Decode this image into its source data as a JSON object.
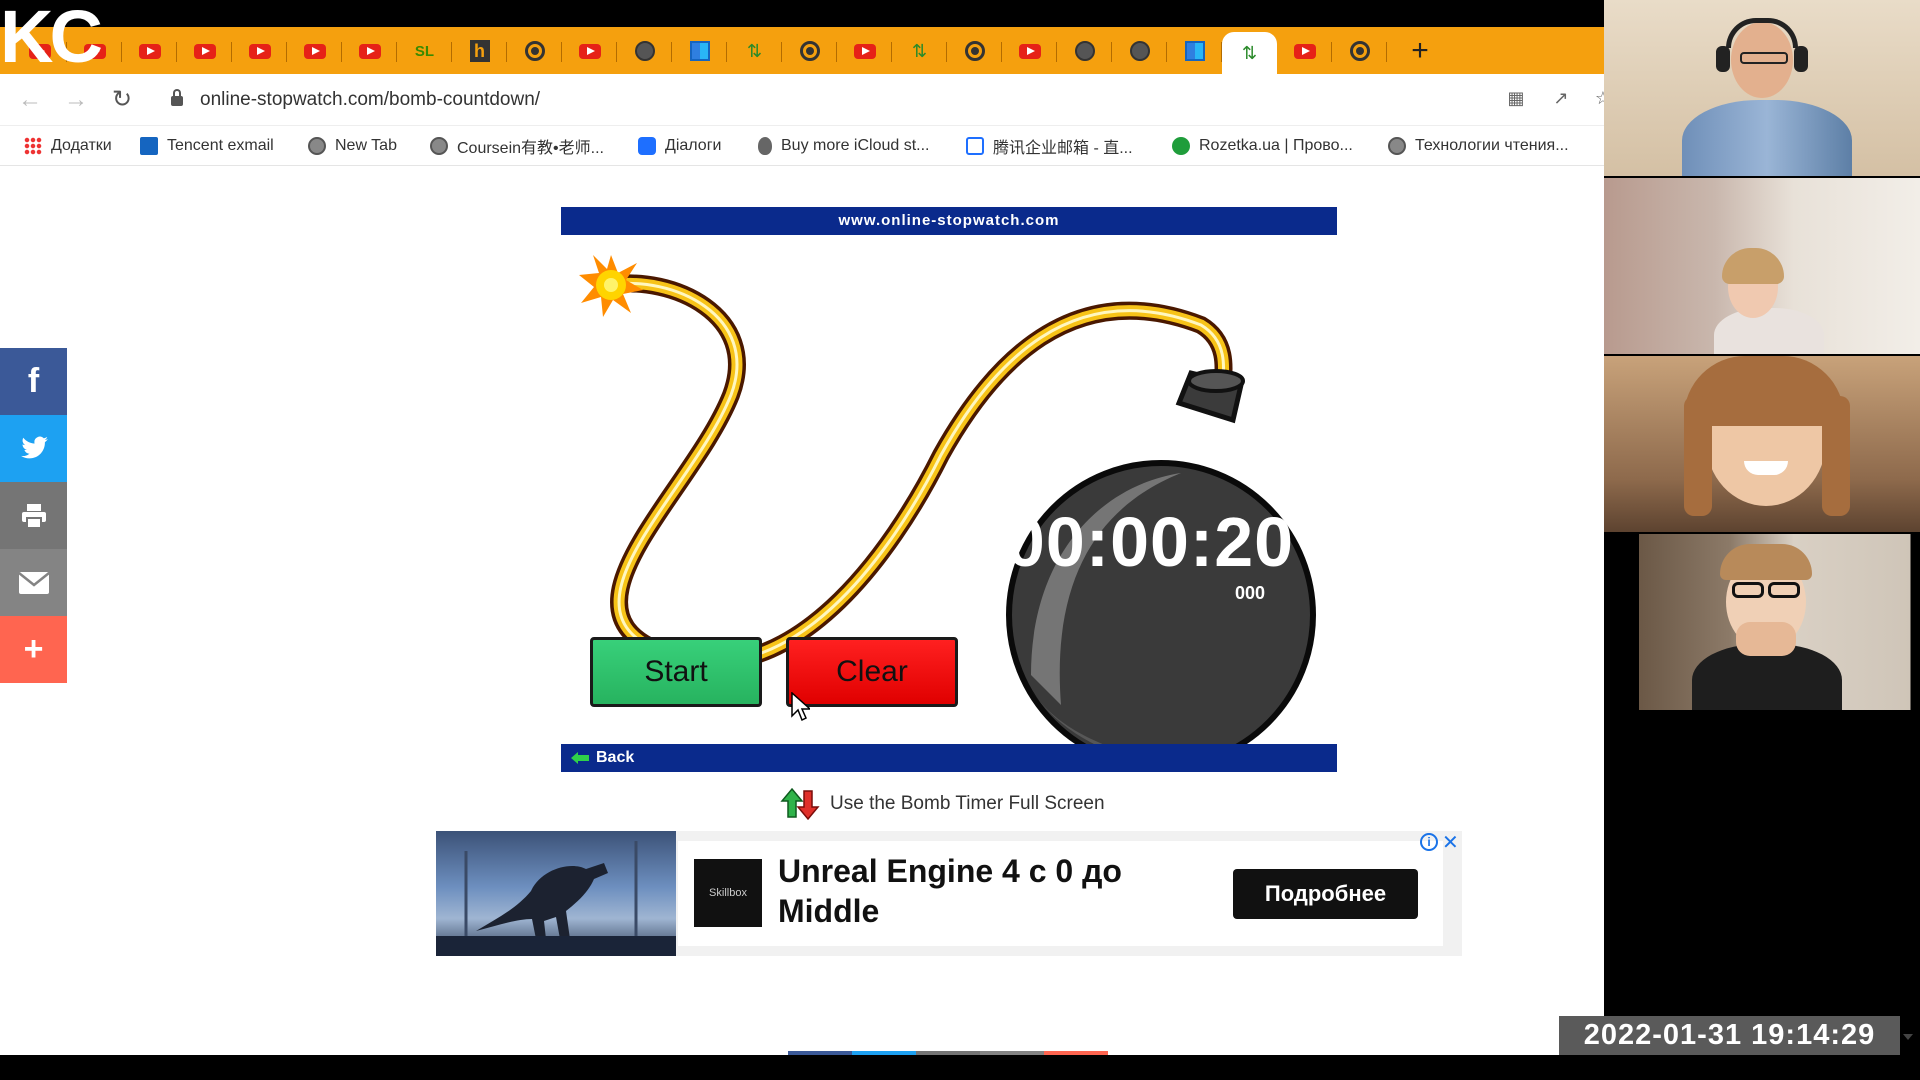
{
  "browser": {
    "logo_text": "KC",
    "url": "online-stopwatch.com/bomb-countdown/",
    "tabs": [
      "youtube",
      "youtube",
      "youtube",
      "youtube",
      "youtube",
      "youtube",
      "youtube",
      "sl",
      "h",
      "chrome",
      "youtube",
      "globe",
      "grid",
      "arrows",
      "chrome",
      "youtube",
      "arrows",
      "chrome",
      "youtube",
      "globe",
      "globe",
      "grid",
      "arrows",
      "youtube",
      "chrome"
    ],
    "active_tab_index": 22,
    "new_tab_label": "+",
    "bookmarks": [
      {
        "icon": "apps-icon",
        "label": "Додатки"
      },
      {
        "icon": "tencent-icon",
        "label": "Tencent exmail"
      },
      {
        "icon": "globe-icon",
        "label": "New Tab"
      },
      {
        "icon": "globe-icon",
        "label": "Coursein有教•老师..."
      },
      {
        "icon": "chat-icon",
        "label": "Діалоги"
      },
      {
        "icon": "apple-icon",
        "label": "Buy more iCloud st..."
      },
      {
        "icon": "qq-icon",
        "label": "腾讯企业邮箱 - 直..."
      },
      {
        "icon": "rozetka-icon",
        "label": "Rozetka.ua | Прово..."
      },
      {
        "icon": "globe-icon",
        "label": "Технологии чтения..."
      }
    ]
  },
  "page": {
    "site_header": "www.online-stopwatch.com",
    "timer": {
      "display": "00:00:20",
      "milliseconds": "000"
    },
    "buttons": {
      "start": "Start",
      "clear": "Clear"
    },
    "back_label": "Back",
    "fullscreen_label": "Use the Bomb Timer Full Screen",
    "share": [
      "f",
      "t",
      "print",
      "mail",
      "+"
    ],
    "colors": {
      "header_blue": "#0a2a8c",
      "start_green": "#27b35f",
      "clear_red": "#e00000",
      "facebook": "#3b5998",
      "twitter": "#1da1f2",
      "print": "#757575",
      "email": "#848484",
      "more": "#ff6550"
    }
  },
  "ad": {
    "brand": "Skillbox",
    "title": "Unreal Engine 4 с 0 до Middle",
    "cta": "Подробнее"
  },
  "overlay": {
    "timestamp": "2022-01-31  19:14:29"
  }
}
